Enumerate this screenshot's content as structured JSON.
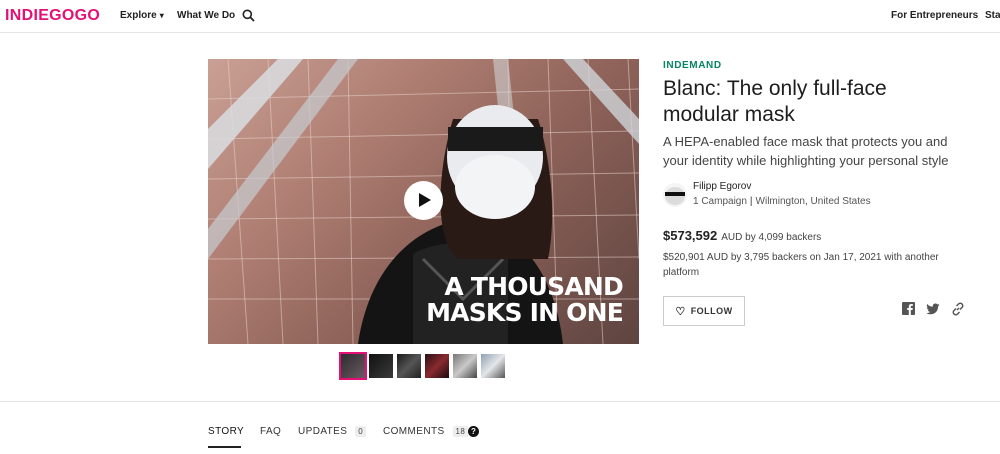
{
  "brand": {
    "logo": "INDIEGOGO",
    "accent": "#e51075",
    "green": "#088366"
  },
  "nav": {
    "explore": "Explore",
    "what_we_do": "What We Do",
    "search_icon": "search-icon",
    "for_entrepreneurs": "For Entrepreneurs",
    "start_campaign": "Start"
  },
  "hero": {
    "overlay_line1": "A THOUSAND",
    "overlay_line2": "MASKS IN ONE",
    "play_icon": "play-icon",
    "thumbnail_count": 6,
    "active_thumbnail": 1
  },
  "campaign": {
    "badge": "INDEMAND",
    "title": "Blanc: The only full-face modular mask",
    "subtitle": "A HEPA-enabled face mask that protects you and your identity while highlighting your personal style",
    "owner": {
      "name": "Filipp Egorov",
      "campaigns": "1 Campaign",
      "separator": "|",
      "location": "Wilmington, United States"
    },
    "funding": {
      "amount": "$573,592",
      "currency_backers": "AUD by 4,099 backers",
      "prior": "$520,901 AUD by 3,795 backers on Jan 17, 2021 with another platform"
    },
    "follow_label": "FOLLOW"
  },
  "tabs": [
    {
      "label": "STORY"
    },
    {
      "label": "FAQ"
    },
    {
      "label": "UPDATES",
      "count": "0"
    },
    {
      "label": "COMMENTS",
      "count": "18"
    }
  ],
  "help_glyph": "?"
}
